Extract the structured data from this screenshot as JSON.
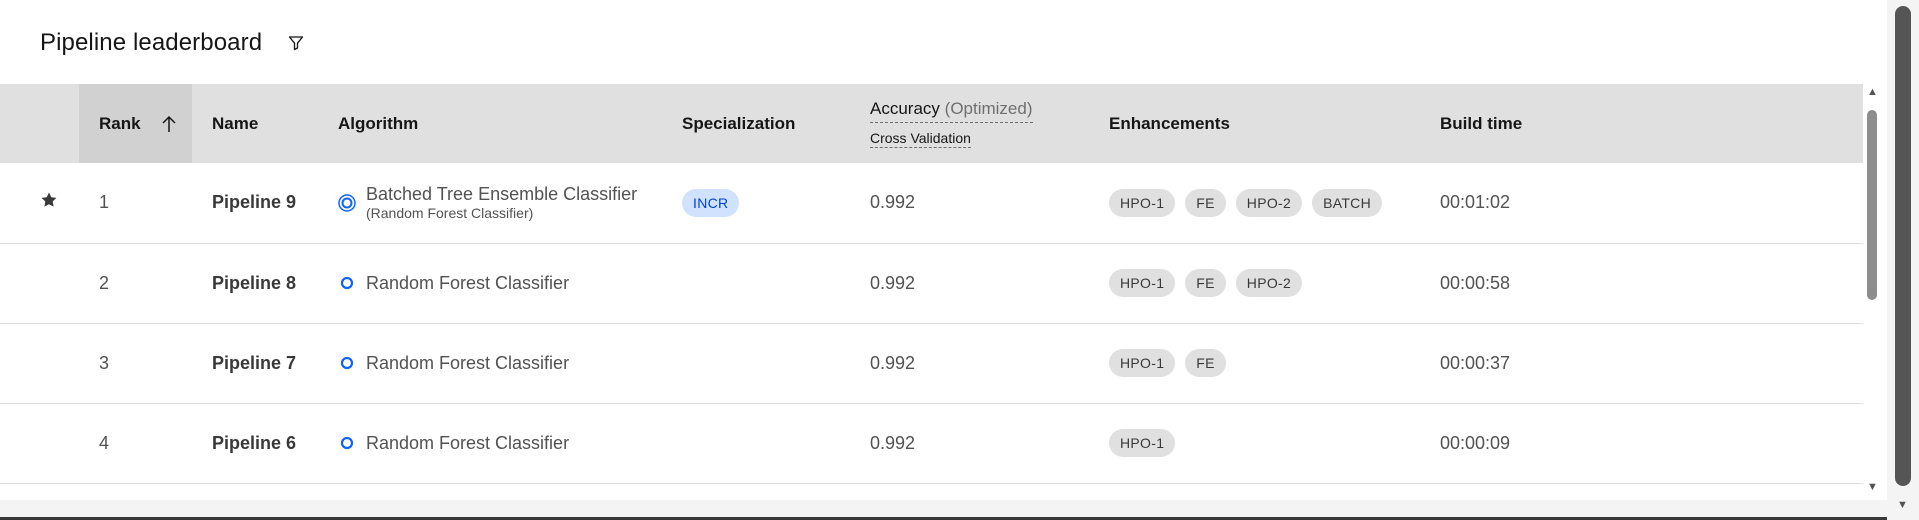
{
  "header": {
    "title": "Pipeline leaderboard",
    "filter_icon": "filter-icon"
  },
  "columns": {
    "rank": "Rank",
    "name": "Name",
    "algorithm": "Algorithm",
    "specialization": "Specialization",
    "accuracy": "Accuracy",
    "accuracy_optimized": "(Optimized)",
    "accuracy_sub": "Cross Validation",
    "enhancements": "Enhancements",
    "build_time": "Build time"
  },
  "rows": [
    {
      "starred": true,
      "rank": "1",
      "name": "Pipeline 9",
      "algorithm": "Batched Tree Ensemble Classifier",
      "algorithm_sub": "(Random Forest Classifier)",
      "specialization": "INCR",
      "accuracy": "0.992",
      "enhancements": [
        "HPO-1",
        "FE",
        "HPO-2",
        "BATCH"
      ],
      "build_time": "00:01:02"
    },
    {
      "starred": false,
      "rank": "2",
      "name": "Pipeline 8",
      "algorithm": "Random Forest Classifier",
      "algorithm_sub": "",
      "specialization": "",
      "accuracy": "0.992",
      "enhancements": [
        "HPO-1",
        "FE",
        "HPO-2"
      ],
      "build_time": "00:00:58"
    },
    {
      "starred": false,
      "rank": "3",
      "name": "Pipeline 7",
      "algorithm": "Random Forest Classifier",
      "algorithm_sub": "",
      "specialization": "",
      "accuracy": "0.992",
      "enhancements": [
        "HPO-1",
        "FE"
      ],
      "build_time": "00:00:37"
    },
    {
      "starred": false,
      "rank": "4",
      "name": "Pipeline 6",
      "algorithm": "Random Forest Classifier",
      "algorithm_sub": "",
      "specialization": "",
      "accuracy": "0.992",
      "enhancements": [
        "HPO-1"
      ],
      "build_time": "00:00:09"
    }
  ],
  "colors": {
    "accent": "#0f62fe",
    "incr_bg": "#d0e2ff",
    "tag_bg": "#e0e0e0",
    "header_bg": "#e0e0e0"
  }
}
